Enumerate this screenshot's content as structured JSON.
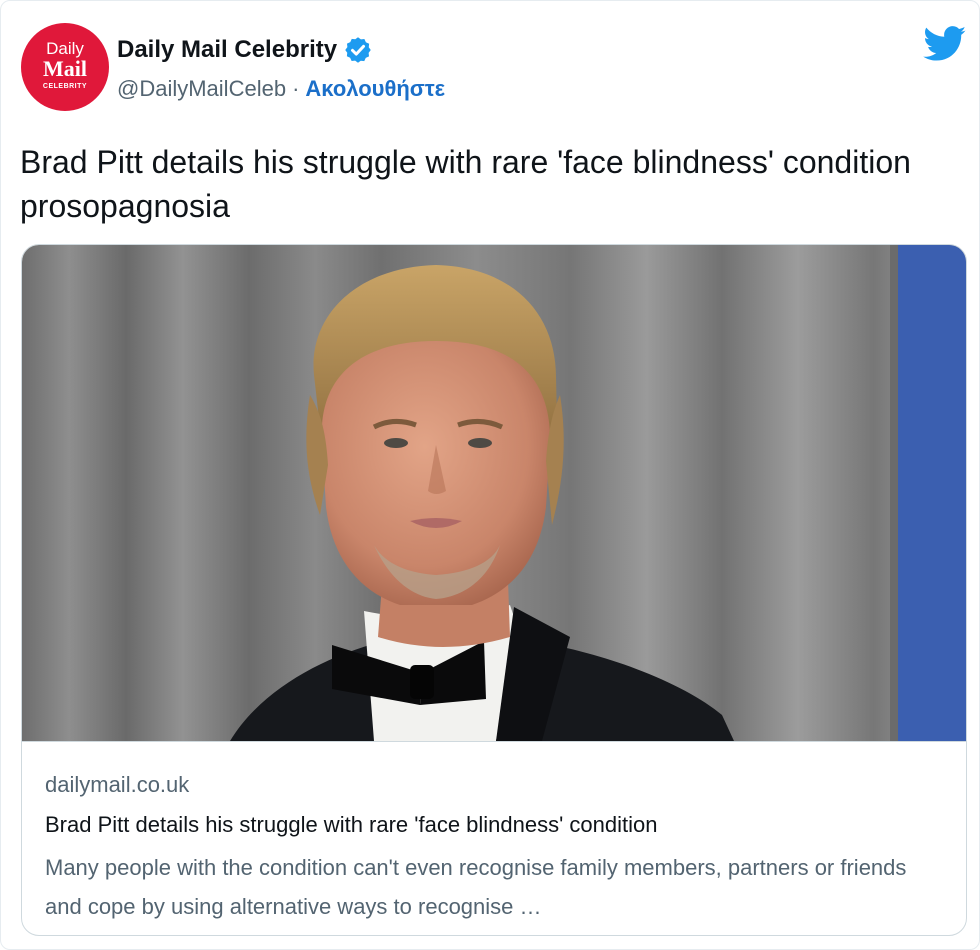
{
  "account": {
    "avatar_line1": "Daily",
    "avatar_line2": "Mail",
    "avatar_line3": "CELEBRITY",
    "display_name": "Daily Mail Celebrity",
    "verified": true,
    "handle": "@DailyMailCeleb",
    "separator": "·",
    "follow_label": "Ακολουθήστε"
  },
  "icons": {
    "verified": "verified-badge-icon",
    "platform": "twitter-bird-icon"
  },
  "tweet": {
    "text": "Brad Pitt details his struggle with rare 'face blindness' condition prosopagnosia"
  },
  "card": {
    "image_subject": "man in tuxedo with bow tie in front of grey curtain",
    "domain": "dailymail.co.uk",
    "title": "Brad Pitt details his struggle with rare 'face blindness' condition",
    "description": "Many people with the condition can't even recognise family members, partners or friends and cope by using alternative ways to recognise …"
  },
  "colors": {
    "brand_red": "#e0183a",
    "twitter_blue": "#1d9bf0",
    "follow_blue": "#1b6fc9",
    "secondary_text": "#536471"
  }
}
